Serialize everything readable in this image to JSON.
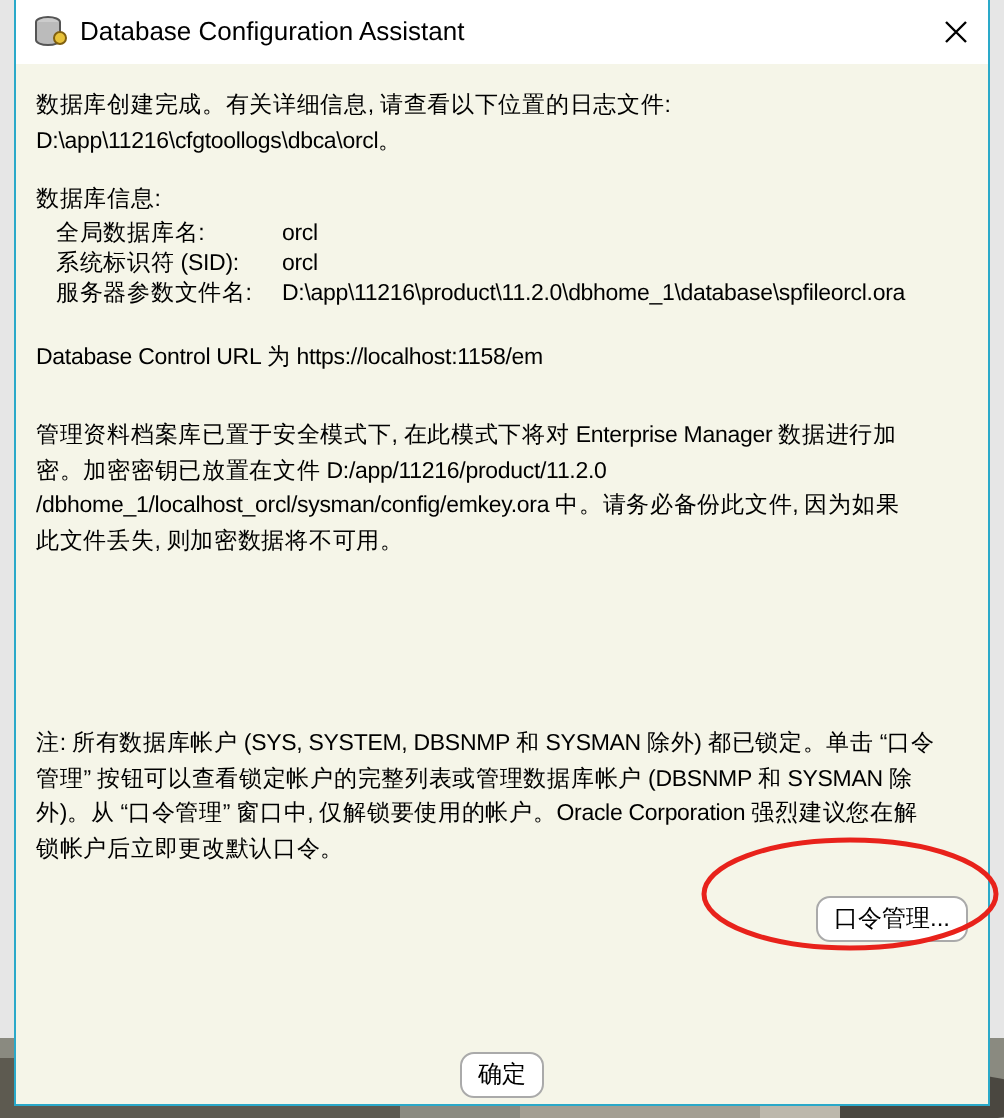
{
  "window": {
    "title": "Database Configuration Assistant"
  },
  "log_message": {
    "lines": [
      "数据库创建完成。有关详细信息, 请查看以下位置的日志文件:",
      " D:\\app\\11216\\cfgtoollogs\\dbca\\orcl。"
    ]
  },
  "database_info": {
    "heading": "数据库信息:",
    "fields": [
      {
        "label": "全局数据库名:",
        "value": "orcl"
      },
      {
        "label": "系统标识符 (SID):",
        "value": "orcl"
      },
      {
        "label": "服务器参数文件名:",
        "value": "D:\\app\\11216\\product\\11.2.0\\dbhome_1\\database\\spfileorcl.ora"
      }
    ]
  },
  "url_message": "Database Control URL 为 https://localhost:1158/em",
  "encryption_message": {
    "lines": [
      "管理资料档案库已置于安全模式下, 在此模式下将对 Enterprise Manager 数据进行加",
      "密。加密密钥已放置在文件 D:/app/11216/product/11.2.0",
      "/dbhome_1/localhost_orcl/sysman/config/emkey.ora 中。请务必备份此文件, 因为如果",
      "此文件丢失, 则加密数据将不可用。"
    ]
  },
  "note_message": {
    "lines": [
      "注: 所有数据库帐户 (SYS, SYSTEM, DBSNMP 和 SYSMAN 除外) 都已锁定。单击 “口令",
      "管理” 按钮可以查看锁定帐户的完整列表或管理数据库帐户 (DBSNMP 和 SYSMAN 除",
      "外)。从 “口令管理” 窗口中, 仅解锁要使用的帐户。Oracle Corporation 强烈建议您在解",
      "锁帐户后立即更改默认口令。"
    ]
  },
  "password_button": "口令管理...",
  "ok_button": "确定"
}
